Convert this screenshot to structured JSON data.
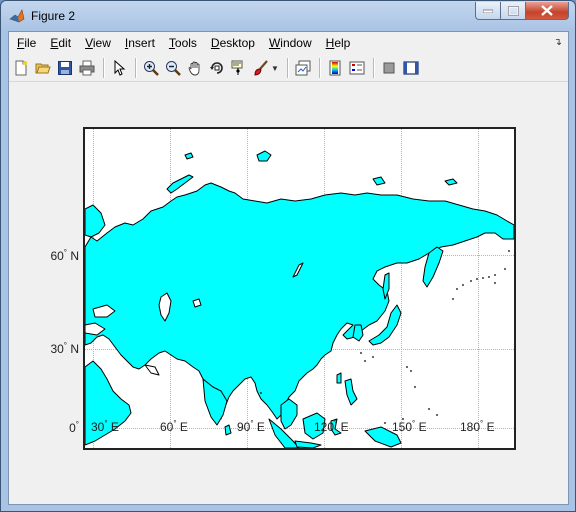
{
  "window": {
    "title": "Figure 2"
  },
  "menu": {
    "items": [
      {
        "key": "F",
        "rest": "ile"
      },
      {
        "key": "E",
        "rest": "dit"
      },
      {
        "key": "V",
        "rest": "iew"
      },
      {
        "key": "I",
        "rest": "nsert"
      },
      {
        "key": "T",
        "rest": "ools"
      },
      {
        "key": "D",
        "rest": "esktop"
      },
      {
        "key": "W",
        "rest": "indow"
      },
      {
        "key": "H",
        "rest": "elp"
      }
    ]
  },
  "toolbar": {
    "icons": [
      "new-figure-icon",
      "open-file-icon",
      "save-icon",
      "print-icon",
      "select-arrow-icon",
      "zoom-in-icon",
      "zoom-out-icon",
      "pan-hand-icon",
      "rotate-3d-icon",
      "data-cursor-icon",
      "brush-icon",
      "link-plot-icon",
      "colorbar-icon",
      "legend-icon",
      "hide-plot-tools-icon",
      "show-plot-tools-icon"
    ]
  },
  "map": {
    "land_color": "#00ffff",
    "lat_labels": [
      {
        "value": "60",
        "hemi": "N"
      },
      {
        "value": "30",
        "hemi": "N"
      },
      {
        "value": "0",
        "hemi": ""
      }
    ],
    "lon_labels": [
      {
        "value": "30",
        "hemi": "E"
      },
      {
        "value": "60",
        "hemi": "E"
      },
      {
        "value": "90",
        "hemi": "E"
      },
      {
        "value": "120",
        "hemi": "E"
      },
      {
        "value": "150",
        "hemi": "E"
      },
      {
        "value": "180",
        "hemi": "E"
      }
    ]
  }
}
